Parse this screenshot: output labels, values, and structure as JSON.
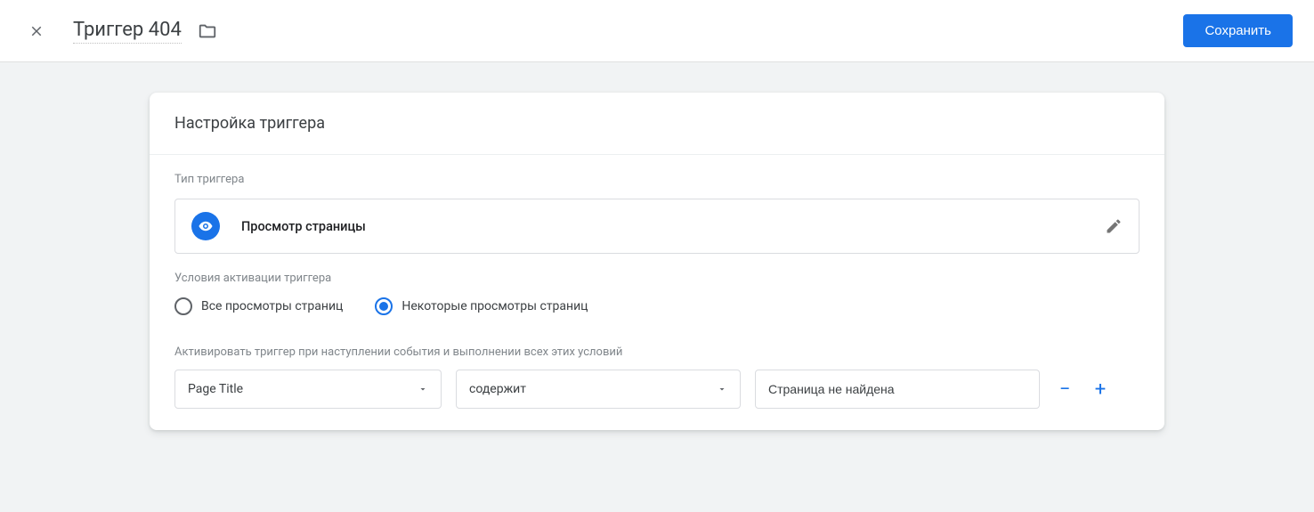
{
  "header": {
    "title": "Триггер 404",
    "save_label": "Сохранить"
  },
  "panel": {
    "heading": "Настройка триггера",
    "type_label": "Тип триггера",
    "type_value": "Просмотр страницы",
    "activation_label": "Условия активации триггера",
    "radio_all": "Все просмотры страниц",
    "radio_some": "Некоторые просмотры страниц",
    "condition_label": "Активировать триггер при наступлении события и выполнении всех этих условий",
    "condition": {
      "variable": "Page Title",
      "operator": "содержит",
      "value": "Страница не найдена"
    }
  }
}
